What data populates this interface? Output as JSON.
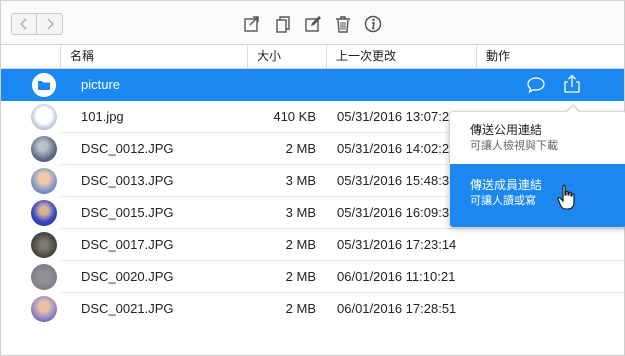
{
  "toolbar": {
    "back_icon": "chevron-left-icon",
    "forward_icon": "chevron-right-icon",
    "tools": [
      "move-to-icon",
      "copy-icon",
      "edit-icon",
      "trash-icon",
      "info-icon"
    ]
  },
  "columns": {
    "name": "名稱",
    "size": "大小",
    "modified": "上一次更改",
    "action": "動作"
  },
  "rows": [
    {
      "name": "picture",
      "size": "",
      "date": "",
      "type": "folder",
      "selected": true
    },
    {
      "name": "101.jpg",
      "size": "410 KB",
      "date": "05/31/2016 13:07:21"
    },
    {
      "name": "DSC_0012.JPG",
      "size": "2 MB",
      "date": "05/31/2016 14:02:28"
    },
    {
      "name": "DSC_0013.JPG",
      "size": "3 MB",
      "date": "05/31/2016 15:48:38"
    },
    {
      "name": "DSC_0015.JPG",
      "size": "3 MB",
      "date": "05/31/2016 16:09:38"
    },
    {
      "name": "DSC_0017.JPG",
      "size": "2 MB",
      "date": "05/31/2016 17:23:14"
    },
    {
      "name": "DSC_0020.JPG",
      "size": "2 MB",
      "date": "06/01/2016 11:10:21"
    },
    {
      "name": "DSC_0021.JPG",
      "size": "2 MB",
      "date": "06/01/2016 17:28:51"
    }
  ],
  "share_menu": {
    "public": {
      "title": "傳送公用連結",
      "subtitle": "可讓人檢視與下載"
    },
    "member": {
      "title": "傳送成員連結",
      "subtitle": "可讓人讀或寫"
    }
  },
  "colors": {
    "accent": "#1a88f0"
  }
}
